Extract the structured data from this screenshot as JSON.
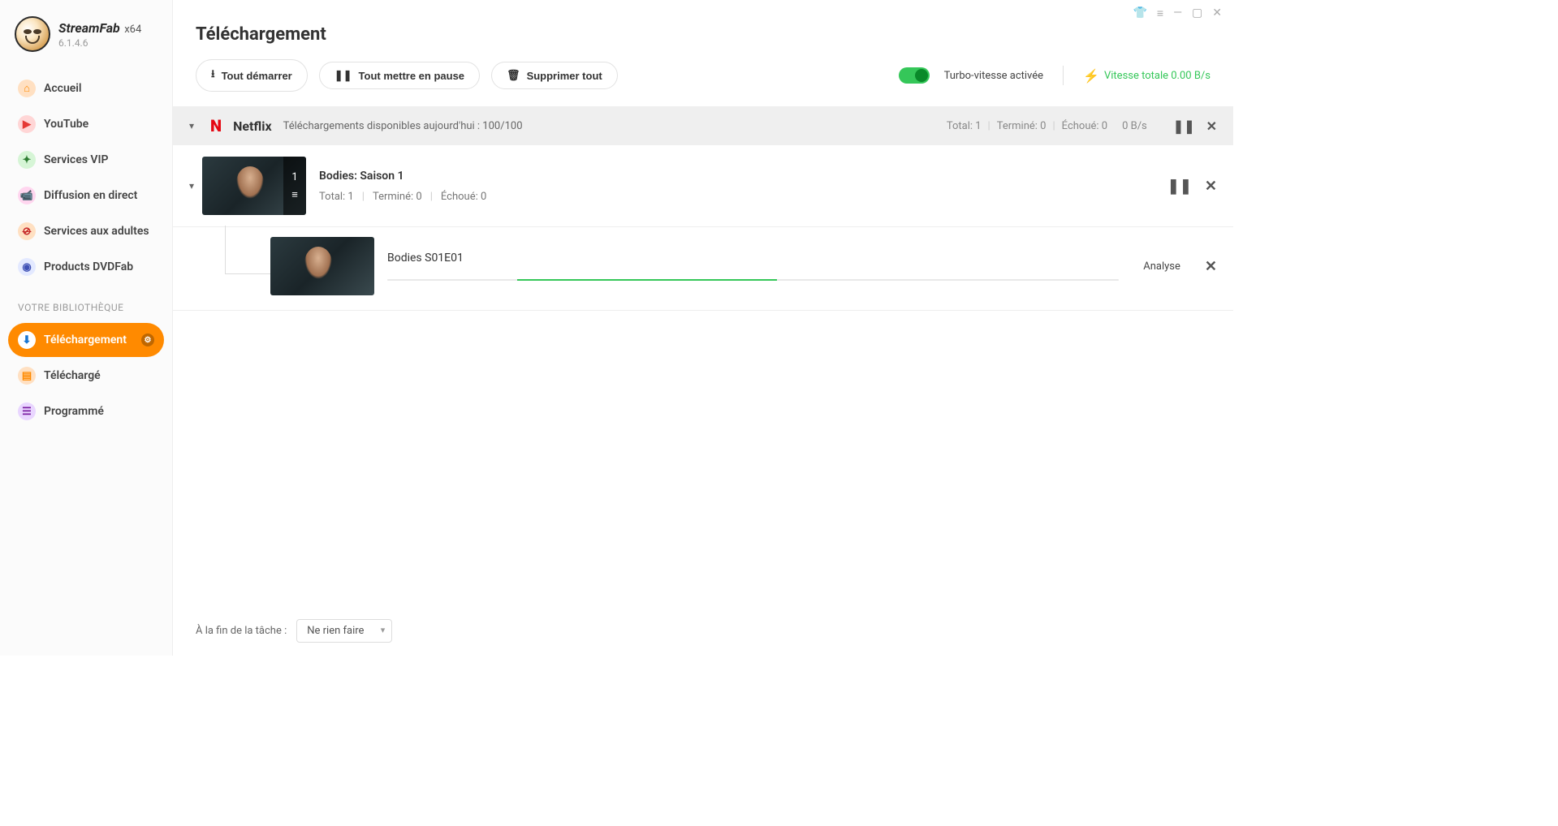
{
  "app": {
    "name": "StreamFab",
    "arch": "x64",
    "version": "6.1.4.6"
  },
  "sidebar": {
    "items": [
      {
        "icon": "home-icon",
        "label": "Accueil"
      },
      {
        "icon": "youtube-icon",
        "label": "YouTube"
      },
      {
        "icon": "vip-icon",
        "label": "Services VIP"
      },
      {
        "icon": "live-icon",
        "label": "Diffusion en direct"
      },
      {
        "icon": "adult-icon",
        "label": "Services aux adultes"
      },
      {
        "icon": "dvdfab-icon",
        "label": "Products DVDFab"
      }
    ],
    "library_label": "VOTRE BIBLIOTHÈQUE",
    "library": [
      {
        "icon": "download-icon",
        "label": "Téléchargement",
        "active": true
      },
      {
        "icon": "downloaded-icon",
        "label": "Téléchargé"
      },
      {
        "icon": "scheduled-icon",
        "label": "Programmé"
      }
    ]
  },
  "page": {
    "title": "Téléchargement"
  },
  "toolbar": {
    "start_all": "Tout démarrer",
    "pause_all": "Tout mettre en pause",
    "delete_all": "Supprimer tout",
    "turbo_label": "Turbo-vitesse activée",
    "speed_total": "Vitesse totale 0.00 B/s"
  },
  "group": {
    "provider": "Netflix",
    "available": "Téléchargements disponibles aujourd'hui : 100/100",
    "stats": {
      "total": "Total: 1",
      "finished": "Terminé: 0",
      "failed": "Échoué: 0",
      "speed": "0 B/s"
    }
  },
  "season": {
    "title": "Bodies: Saison 1",
    "badge_count": "1",
    "stats": {
      "total": "Total: 1",
      "finished": "Terminé: 0",
      "failed": "Échoué: 0"
    }
  },
  "episode": {
    "title": "Bodies S01E01",
    "status": "Analyse"
  },
  "footer": {
    "label": "À la fin de la tâche :",
    "select_value": "Ne rien faire"
  }
}
